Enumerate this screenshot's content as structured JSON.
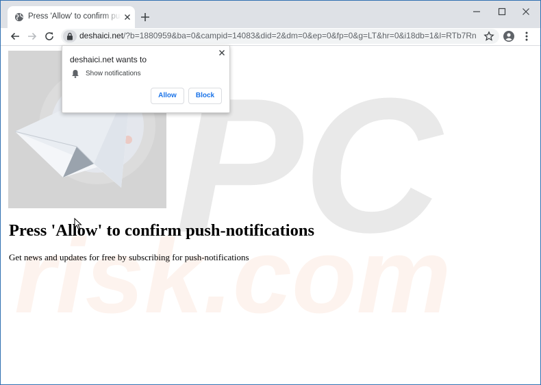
{
  "tab": {
    "title": "Press 'Allow' to confirm push-notifications"
  },
  "address_bar": {
    "host": "deshaici.net",
    "path": "/?b=1880959&ba=0&campid=14083&did=2&dm=0&ep=0&fp=0&g=LT&hr=0&i18db=1&l=RTb7RnUG2kv..."
  },
  "popup": {
    "title": "deshaici.net wants to",
    "permission": "Show notifications",
    "allow_label": "Allow",
    "block_label": "Block"
  },
  "page": {
    "headline": "Press 'Allow' to confirm push-notifications",
    "subtext": "Get news and updates for free by subscribing for push-notifications"
  },
  "watermark": {
    "top": "PC",
    "bottom": "risk.com"
  },
  "icons": {
    "favicon": "globe-icon",
    "tab_close": "close-icon",
    "new_tab": "plus-icon",
    "minimize": "minimize-icon",
    "maximize": "maximize-icon",
    "close_window": "close-icon",
    "back": "arrow-left-icon",
    "forward": "arrow-right-icon",
    "reload": "reload-icon",
    "lock": "lock-icon",
    "bookmark": "star-icon",
    "profile": "account-icon",
    "menu": "more-vert-icon",
    "popup_close": "close-icon",
    "notification": "bell-icon",
    "hero": "paper-plane-icon"
  },
  "colors": {
    "frame": "#dee1e6",
    "window_border": "#2f6fb0",
    "button_text": "#1a73e8",
    "watermark_orange": "#f5a27a"
  }
}
